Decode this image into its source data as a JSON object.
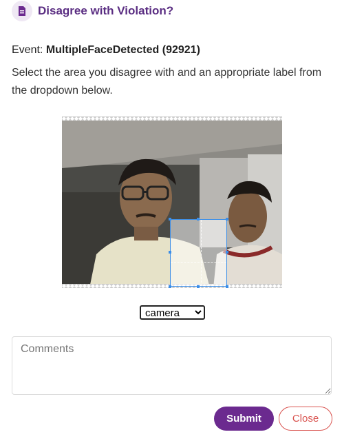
{
  "dialog": {
    "title": "Disagree with Violation?",
    "event_label": "Event:",
    "event_value": "MultipleFaceDetected (92921)",
    "instructions": "Select the area you disagree with and an appropriate label from the dropdown below."
  },
  "label_select": {
    "selected": "camera",
    "options": [
      "camera"
    ]
  },
  "comments": {
    "placeholder": "Comments",
    "value": ""
  },
  "buttons": {
    "submit": "Submit",
    "close": "Close"
  },
  "colors": {
    "accent": "#6b2a8f",
    "title": "#5a2d82",
    "close": "#d9534f",
    "selection": "#3b8ee8"
  },
  "icons": {
    "header": "document-icon"
  }
}
